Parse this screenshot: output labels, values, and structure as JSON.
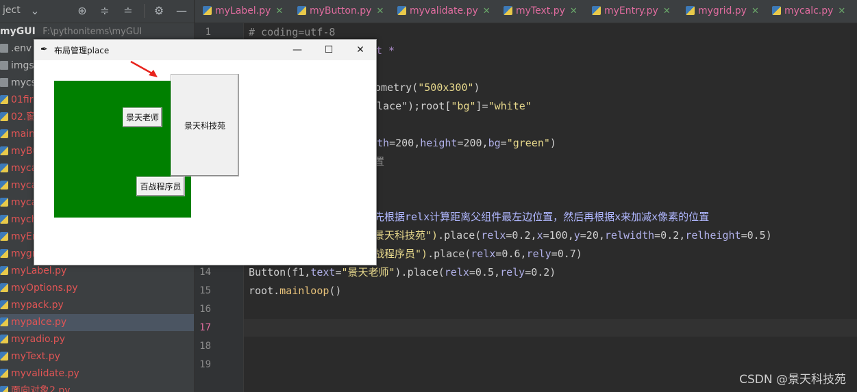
{
  "project_panel": {
    "label": "ject",
    "root": {
      "name": "myGUI",
      "path": "F:\\pythonitems\\myGUI"
    },
    "items": [
      {
        "name": ".env",
        "kind": "folder",
        "plain": true
      },
      {
        "name": "imgs",
        "kind": "folder",
        "plain": true
      },
      {
        "name": "mycs",
        "kind": "folder",
        "plain": true
      },
      {
        "name": "01firs",
        "kind": "py"
      },
      {
        "name": "02.窗",
        "kind": "py"
      },
      {
        "name": "main",
        "kind": "py"
      },
      {
        "name": "myBu",
        "kind": "py"
      },
      {
        "name": "myca",
        "kind": "py"
      },
      {
        "name": "myca",
        "kind": "py"
      },
      {
        "name": "myca",
        "kind": "py"
      },
      {
        "name": "mych",
        "kind": "py"
      },
      {
        "name": "myEr",
        "kind": "py"
      },
      {
        "name": "mygr",
        "kind": "py"
      },
      {
        "name": "myLabel.py",
        "kind": "py"
      },
      {
        "name": "myOptions.py",
        "kind": "py"
      },
      {
        "name": "mypack.py",
        "kind": "py"
      },
      {
        "name": "mypalce.py",
        "kind": "py",
        "selected": true
      },
      {
        "name": "myradio.py",
        "kind": "py"
      },
      {
        "name": "myText.py",
        "kind": "py"
      },
      {
        "name": "myvalidate.py",
        "kind": "py"
      },
      {
        "name": "面向对象2.py",
        "kind": "py"
      }
    ]
  },
  "tabs": [
    {
      "label": "myLabel.py"
    },
    {
      "label": "myButton.py"
    },
    {
      "label": "myvalidate.py"
    },
    {
      "label": "myText.py"
    },
    {
      "label": "myEntry.py"
    },
    {
      "label": "mygrid.py"
    },
    {
      "label": "mycalc.py"
    }
  ],
  "line_numbers": [
    "1",
    "14",
    "15",
    "16",
    "17",
    "18",
    "19"
  ],
  "current_line": "17",
  "code": {
    "l1": "# coding=utf-8",
    "l2_star": "t *",
    "l4a": "eometry(",
    "l4b": "\"500x300\"",
    "l4c": ")",
    "l5a": "place\");root[",
    "l5b": "\"bg\"",
    "l5c": "]=",
    "l5d": "\"white\"",
    "l7a": "dth",
    "l7b": "=200,",
    "l7c": "height",
    "l7d": "=200,",
    "l7e": "bg",
    "l7f": "=",
    "l7g": "\"green\"",
    "l7h": ")",
    "l8": "置",
    "l11": "先根据relx计算距离父组件最左边位置，然后再根据x来加减x像素的位置",
    "l12a": "景天科技苑\")",
    "l12b": ".place(",
    "l12c": "relx",
    "l12d": "=0.2,",
    "l12e": "x",
    "l12f": "=100,",
    "l12g": "y",
    "l12h": "=20,",
    "l12i": "relwidth",
    "l12j": "=0.2,",
    "l12k": "relheight",
    "l12l": "=0.5)",
    "l13a": "战程序员\")",
    "l13b": ".place(",
    "l13c": "relx",
    "l13d": "=0.6,",
    "l13e": "rely",
    "l13f": "=0.7)",
    "l14a": "Button(f1,",
    "l14b": "text",
    "l14c": "=",
    "l14d": "\"景天老师\"",
    "l14e": ").place(",
    "l14f": "relx",
    "l14g": "=0.5,",
    "l14h": "rely",
    "l14i": "=0.2)",
    "l15a": "root.",
    "l15b": "mainloop",
    "l15c": "()"
  },
  "tk_window": {
    "title": "布局管理place",
    "minimize": "—",
    "maximize": "☐",
    "close": "✕",
    "buttons": {
      "teacher": "景天老师",
      "garden": "景天科技苑",
      "programmer": "百战程序员"
    },
    "frame_color": "#008000"
  },
  "watermark": "CSDN @景天科技苑"
}
